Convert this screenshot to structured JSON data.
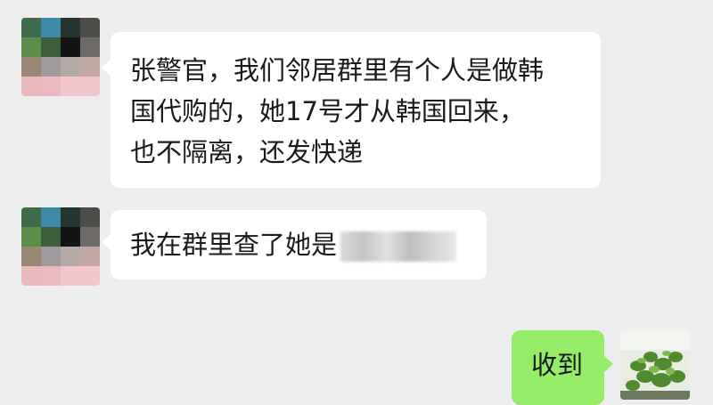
{
  "messages": [
    {
      "sender": "other",
      "lines": [
        "张警官，我们邻居群里有个人是做韩",
        "国代购的，她17号才从韩国回来，",
        "也不隔离，还发快递"
      ]
    },
    {
      "sender": "other",
      "text": "我在群里查了她是",
      "redacted": true
    },
    {
      "sender": "self",
      "text": "收到"
    }
  ],
  "colors": {
    "background": "#ededed",
    "incoming_bubble": "#ffffff",
    "outgoing_bubble": "#95ec69",
    "text": "#1a1a1a"
  },
  "avatar_pixels": [
    "#3e6b4c",
    "#3f8aa8",
    "#253532",
    "#4c4c48",
    "#5c8d49",
    "#3c5e3a",
    "#121513",
    "#6e6a66",
    "#9a8874",
    "#a09a9c",
    "#b4aaa6",
    "#c2a7a2",
    "#e8b9bd",
    "#ebb9c0",
    "#f0c8cc",
    "#f0c8cc"
  ],
  "self_avatar_icon": "plant-photo-icon"
}
